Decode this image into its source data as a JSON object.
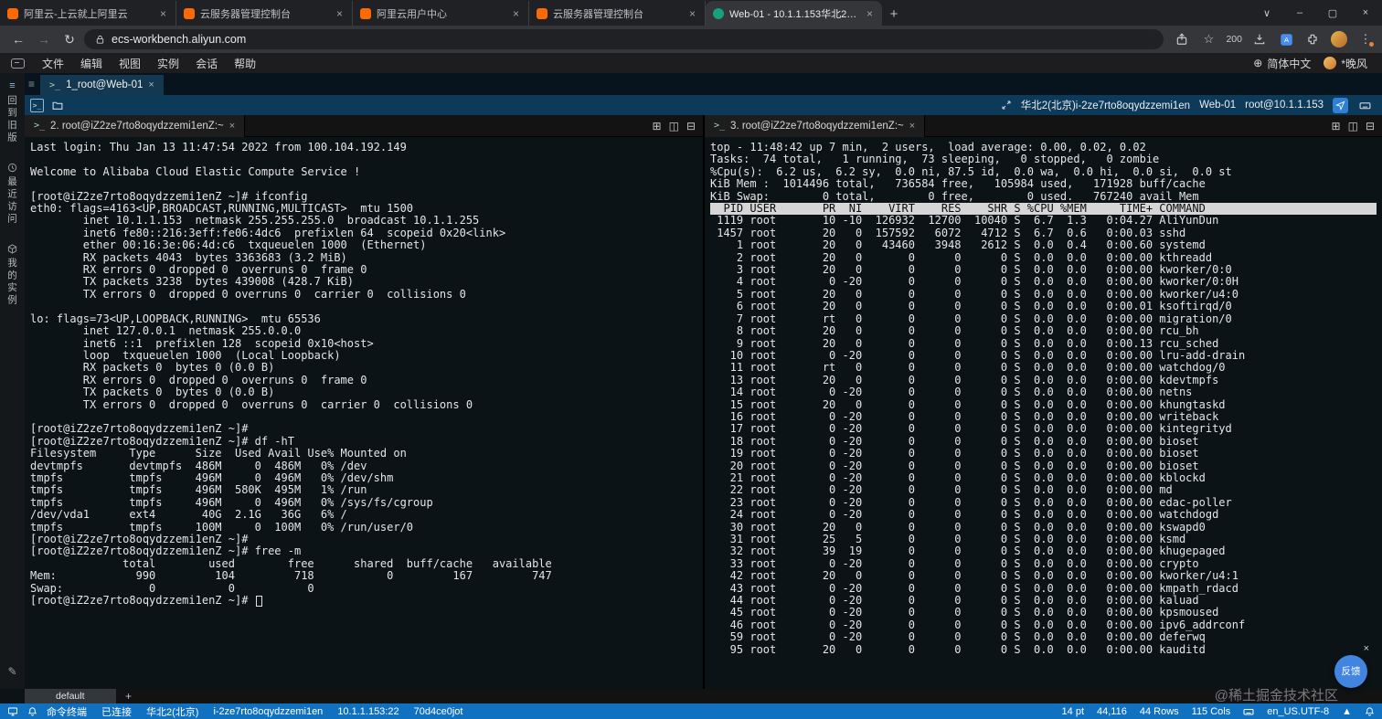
{
  "colors": {
    "status_bar_bg": "#1071c1",
    "session_bar_bg": "#0e3a5a",
    "terminal_bg": "#0c1316",
    "top_table_header_bg": "#d6d6d6",
    "feedback_button_bg": "#4285e0",
    "aliyun_brand_orange": "#ff6a00",
    "active_tab_favicon": "#16a07c"
  },
  "icons": {
    "back": "←",
    "forward": "→",
    "reload": "↻",
    "star": "☆",
    "kebab": "⋮",
    "close": "×",
    "new_tab": "+",
    "globe": "⊕",
    "menu": "≡",
    "terminal_prompt": ">_",
    "split_h": "⊞",
    "split_v": "◫",
    "collapse": "⊟",
    "up": "▲",
    "chevron_down": "∨",
    "minimize": "–",
    "maximize": "▢",
    "wand": "✎"
  },
  "browser": {
    "tabs": [
      {
        "title": "阿里云-上云就上阿里云"
      },
      {
        "title": "云服务器管理控制台"
      },
      {
        "title": "阿里云用户中心"
      },
      {
        "title": "云服务器管理控制台"
      },
      {
        "title": "Web-01 - 10.1.1.153华北2(北.."
      }
    ],
    "url": "ecs-workbench.aliyun.com",
    "zoom_badge": "200"
  },
  "menubar": {
    "items": [
      "文件",
      "编辑",
      "视图",
      "实例",
      "会话",
      "帮助"
    ],
    "language": "简体中文",
    "user": "*晚风"
  },
  "sidebar": {
    "items": [
      {
        "label": "回到旧版"
      },
      {
        "label": "最近访问"
      },
      {
        "label": "我的实例"
      }
    ]
  },
  "workspace": {
    "tab": "1_root@Web-01",
    "session_bar": {
      "instance": "华北2(北京)i-2ze7rto8oqydzzemi1en",
      "host": "Web-01",
      "user_at_ip": "root@10.1.1.153"
    }
  },
  "left_pane": {
    "tab": "2. root@iZ2ze7rto8oqydzzemi1enZ:~",
    "lines": [
      "Last login: Thu Jan 13 11:47:54 2022 from 100.104.192.149",
      "",
      "Welcome to Alibaba Cloud Elastic Compute Service !",
      "",
      "[root@iZ2ze7rto8oqydzzemi1enZ ~]# ifconfig",
      "eth0: flags=4163<UP,BROADCAST,RUNNING,MULTICAST>  mtu 1500",
      "        inet 10.1.1.153  netmask 255.255.255.0  broadcast 10.1.1.255",
      "        inet6 fe80::216:3eff:fe06:4dc6  prefixlen 64  scopeid 0x20<link>",
      "        ether 00:16:3e:06:4d:c6  txqueuelen 1000  (Ethernet)",
      "        RX packets 4043  bytes 3363683 (3.2 MiB)",
      "        RX errors 0  dropped 0  overruns 0  frame 0",
      "        TX packets 3238  bytes 439008 (428.7 KiB)",
      "        TX errors 0  dropped 0 overruns 0  carrier 0  collisions 0",
      "",
      "lo: flags=73<UP,LOOPBACK,RUNNING>  mtu 65536",
      "        inet 127.0.0.1  netmask 255.0.0.0",
      "        inet6 ::1  prefixlen 128  scopeid 0x10<host>",
      "        loop  txqueuelen 1000  (Local Loopback)",
      "        RX packets 0  bytes 0 (0.0 B)",
      "        RX errors 0  dropped 0  overruns 0  frame 0",
      "        TX packets 0  bytes 0 (0.0 B)",
      "        TX errors 0  dropped 0  overruns 0  carrier 0  collisions 0",
      "",
      "[root@iZ2ze7rto8oqydzzemi1enZ ~]#",
      "[root@iZ2ze7rto8oqydzzemi1enZ ~]# df -hT",
      "Filesystem     Type      Size  Used Avail Use% Mounted on",
      "devtmpfs       devtmpfs  486M     0  486M   0% /dev",
      "tmpfs          tmpfs     496M     0  496M   0% /dev/shm",
      "tmpfs          tmpfs     496M  580K  495M   1% /run",
      "tmpfs          tmpfs     496M     0  496M   0% /sys/fs/cgroup",
      "/dev/vda1      ext4       40G  2.1G   36G   6% /",
      "tmpfs          tmpfs     100M     0  100M   0% /run/user/0",
      "[root@iZ2ze7rto8oqydzzemi1enZ ~]#",
      "[root@iZ2ze7rto8oqydzzemi1enZ ~]# free -m",
      "              total        used        free      shared  buff/cache   available",
      "Mem:            990         104         718           0         167         747",
      "Swap:             0           0           0"
    ],
    "prompt": "[root@iZ2ze7rto8oqydzzemi1enZ ~]# "
  },
  "right_pane": {
    "tab": "3. root@iZ2ze7rto8oqydzzemi1enZ:~",
    "summary_lines": [
      "top - 11:48:42 up 7 min,  2 users,  load average: 0.00, 0.02, 0.02",
      "Tasks:  74 total,   1 running,  73 sleeping,   0 stopped,   0 zombie",
      "%Cpu(s):  6.2 us,  6.2 sy,  0.0 ni, 87.5 id,  0.0 wa,  0.0 hi,  0.0 si,  0.0 st",
      "KiB Mem :  1014496 total,   736584 free,   105984 used,   171928 buff/cache",
      "KiB Swap:        0 total,        0 free,        0 used.   767240 avail Mem",
      ""
    ],
    "table_header": "  PID USER       PR  NI    VIRT    RES    SHR S %CPU %MEM     TIME+ COMMAND",
    "process_lines": [
      " 1119 root       10 -10  126932  12700  10040 S  6.7  1.3   0:04.27 AliYunDun",
      " 1457 root       20   0  157592   6072   4712 S  6.7  0.6   0:00.03 sshd",
      "    1 root       20   0   43460   3948   2612 S  0.0  0.4   0:00.60 systemd",
      "    2 root       20   0       0      0      0 S  0.0  0.0   0:00.00 kthreadd",
      "    3 root       20   0       0      0      0 S  0.0  0.0   0:00.00 kworker/0:0",
      "    4 root        0 -20       0      0      0 S  0.0  0.0   0:00.00 kworker/0:0H",
      "    5 root       20   0       0      0      0 S  0.0  0.0   0:00.00 kworker/u4:0",
      "    6 root       20   0       0      0      0 S  0.0  0.0   0:00.01 ksoftirqd/0",
      "    7 root       rt   0       0      0      0 S  0.0  0.0   0:00.00 migration/0",
      "    8 root       20   0       0      0      0 S  0.0  0.0   0:00.00 rcu_bh",
      "    9 root       20   0       0      0      0 S  0.0  0.0   0:00.13 rcu_sched",
      "   10 root        0 -20       0      0      0 S  0.0  0.0   0:00.00 lru-add-drain",
      "   11 root       rt   0       0      0      0 S  0.0  0.0   0:00.00 watchdog/0",
      "   13 root       20   0       0      0      0 S  0.0  0.0   0:00.00 kdevtmpfs",
      "   14 root        0 -20       0      0      0 S  0.0  0.0   0:00.00 netns",
      "   15 root       20   0       0      0      0 S  0.0  0.0   0:00.00 khungtaskd",
      "   16 root        0 -20       0      0      0 S  0.0  0.0   0:00.00 writeback",
      "   17 root        0 -20       0      0      0 S  0.0  0.0   0:00.00 kintegrityd",
      "   18 root        0 -20       0      0      0 S  0.0  0.0   0:00.00 bioset",
      "   19 root        0 -20       0      0      0 S  0.0  0.0   0:00.00 bioset",
      "   20 root        0 -20       0      0      0 S  0.0  0.0   0:00.00 bioset",
      "   21 root        0 -20       0      0      0 S  0.0  0.0   0:00.00 kblockd",
      "   22 root        0 -20       0      0      0 S  0.0  0.0   0:00.00 md",
      "   23 root        0 -20       0      0      0 S  0.0  0.0   0:00.00 edac-poller",
      "   24 root        0 -20       0      0      0 S  0.0  0.0   0:00.00 watchdogd",
      "   30 root       20   0       0      0      0 S  0.0  0.0   0:00.00 kswapd0",
      "   31 root       25   5       0      0      0 S  0.0  0.0   0:00.00 ksmd",
      "   32 root       39  19       0      0      0 S  0.0  0.0   0:00.00 khugepaged",
      "   33 root        0 -20       0      0      0 S  0.0  0.0   0:00.00 crypto",
      "   42 root       20   0       0      0      0 S  0.0  0.0   0:00.00 kworker/u4:1",
      "   43 root        0 -20       0      0      0 S  0.0  0.0   0:00.00 kmpath_rdacd",
      "   44 root        0 -20       0      0      0 S  0.0  0.0   0:00.00 kaluad",
      "   45 root        0 -20       0      0      0 S  0.0  0.0   0:00.00 kpsmoused",
      "   46 root        0 -20       0      0      0 S  0.0  0.0   0:00.00 ipv6_addrconf",
      "   59 root        0 -20       0      0      0 S  0.0  0.0   0:00.00 deferwq",
      "   95 root       20   0       0      0      0 S  0.0  0.0   0:00.00 kauditd"
    ]
  },
  "bottom_bar": {
    "tab": "default"
  },
  "status_bar": {
    "left": [
      "命令终端",
      "已连接",
      "华北2(北京)",
      "i-2ze7rto8oqydzzemi1en",
      "10.1.1.153:22",
      "70d4ce0jot"
    ],
    "right": [
      "14 pt",
      "44,116",
      "44 Rows",
      "115 Cols",
      "en_US.UTF-8"
    ]
  },
  "overlay": {
    "watermark": "@稀土掘金技术社区",
    "feedback": "反馈"
  }
}
